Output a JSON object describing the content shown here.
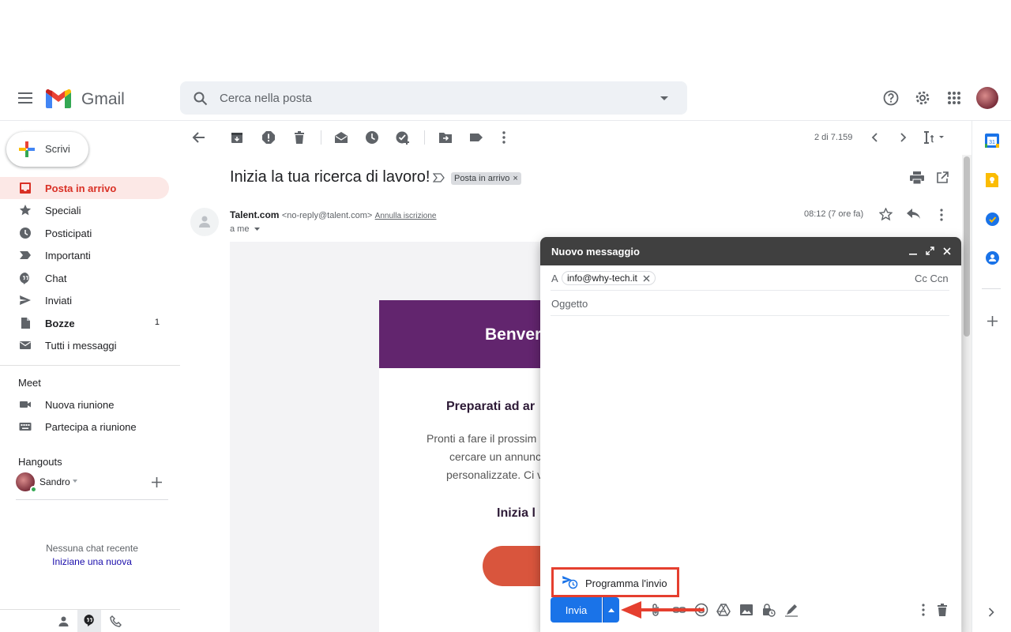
{
  "app": {
    "name": "Gmail"
  },
  "search": {
    "placeholder": "Cerca nella posta"
  },
  "sidebar": {
    "compose_label": "Scrivi",
    "items": [
      {
        "label": "Posta in arrivo",
        "count": ""
      },
      {
        "label": "Speciali",
        "count": ""
      },
      {
        "label": "Posticipati",
        "count": ""
      },
      {
        "label": "Importanti",
        "count": ""
      },
      {
        "label": "Chat",
        "count": ""
      },
      {
        "label": "Inviati",
        "count": ""
      },
      {
        "label": "Bozze",
        "count": "1"
      },
      {
        "label": "Tutti i messaggi",
        "count": ""
      }
    ],
    "meet": {
      "title": "Meet",
      "items": [
        "Nuova riunione",
        "Partecipa a riunione"
      ]
    },
    "hangouts": {
      "title": "Hangouts",
      "user": "Sandro",
      "empty_text": "Nessuna chat recente",
      "start_link": "Iniziane una nuova"
    }
  },
  "toolbar": {
    "pagination": "2 di 7.159"
  },
  "email": {
    "subject": "Inizia la tua ricerca di lavoro!",
    "label": "Posta in arrivo",
    "sender_name": "Talent.com",
    "sender_email": "<no-reply@talent.com>",
    "unsubscribe": "Annulla iscrizione",
    "to": "a me",
    "time": "08:12 (7 ore fa)",
    "body": {
      "header": "Benver",
      "heading": "Preparati ad ar",
      "lines": [
        "Pronti a fare il prossim",
        "cercare un annunc",
        "personalizzate. Ci v"
      ],
      "cta_heading": "Inizia l"
    }
  },
  "compose": {
    "title": "Nuovo messaggio",
    "to_label": "A",
    "recipient": "info@why-tech.it",
    "cc_bcc": "Cc Ccn",
    "subject_placeholder": "Oggetto",
    "schedule_label": "Programma l'invio",
    "send_label": "Invia"
  },
  "colors": {
    "accent_blue": "#1a73e8",
    "gmail_red": "#d93025",
    "highlight_red": "#e53f2f",
    "email_purple": "#62256e",
    "cta_orange": "#d9553d"
  }
}
